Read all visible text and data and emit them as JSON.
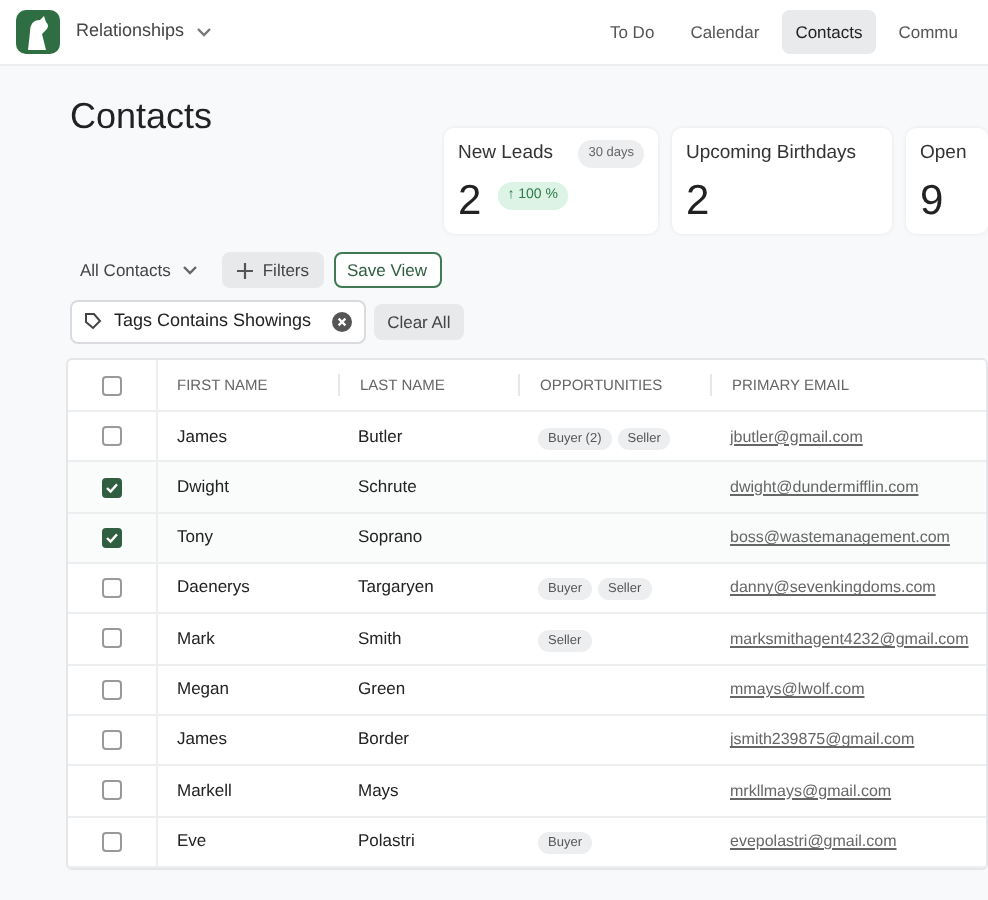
{
  "app": {
    "title": "Relationships"
  },
  "nav": [
    {
      "label": "To Do",
      "selected": false
    },
    {
      "label": "Calendar",
      "selected": false
    },
    {
      "label": "Contacts",
      "selected": true
    },
    {
      "label": "Commu",
      "selected": false
    }
  ],
  "page_title": "Contacts",
  "stats": [
    {
      "title": "New Leads",
      "period": "30 days",
      "value": "2",
      "change": "↑ 100 %"
    },
    {
      "title": "Upcoming Birthdays",
      "value": "2"
    },
    {
      "title": "Open",
      "value": "9"
    }
  ],
  "view": {
    "label": "All Contacts",
    "filters_button": "Filters",
    "save_button": "Save View"
  },
  "active_filters": [
    {
      "label": "Tags Contains Showings"
    }
  ],
  "clear_all": "Clear All",
  "table": {
    "select_all": {
      "checked": false
    },
    "columns": [
      "FIRST NAME",
      "LAST NAME",
      "OPPORTUNITIES",
      "PRIMARY EMAIL"
    ],
    "rows": [
      {
        "checked": false,
        "first_name": "James",
        "last_name": "Butler",
        "opportunities": [
          "Buyer (2)",
          "Seller"
        ],
        "email": "jbutler@gmail.com"
      },
      {
        "checked": true,
        "first_name": "Dwight",
        "last_name": "Schrute",
        "opportunities": [],
        "email": "dwight@dundermifflin.com"
      },
      {
        "checked": true,
        "first_name": "Tony",
        "last_name": "Soprano",
        "opportunities": [],
        "email": "boss@wastemanagement.com"
      },
      {
        "checked": false,
        "first_name": "Daenerys",
        "last_name": "Targaryen",
        "opportunities": [
          "Buyer",
          "Seller"
        ],
        "email": "danny@sevenkingdoms.com"
      },
      {
        "checked": false,
        "first_name": "Mark",
        "last_name": "Smith",
        "opportunities": [
          "Seller"
        ],
        "email": "marksmithagent4232@gmail.com"
      },
      {
        "checked": false,
        "first_name": "Megan",
        "last_name": "Green",
        "opportunities": [],
        "email": "mmays@lwolf.com"
      },
      {
        "checked": false,
        "first_name": "James",
        "last_name": "Border",
        "opportunities": [],
        "email": "jsmith239875@gmail.com"
      },
      {
        "checked": false,
        "first_name": "Markell",
        "last_name": "Mays",
        "opportunities": [],
        "email": "mrkllmays@gmail.com"
      },
      {
        "checked": false,
        "first_name": "Eve",
        "last_name": "Polastri",
        "opportunities": [
          "Buyer"
        ],
        "email": "evepolastri@gmail.com"
      }
    ]
  }
}
